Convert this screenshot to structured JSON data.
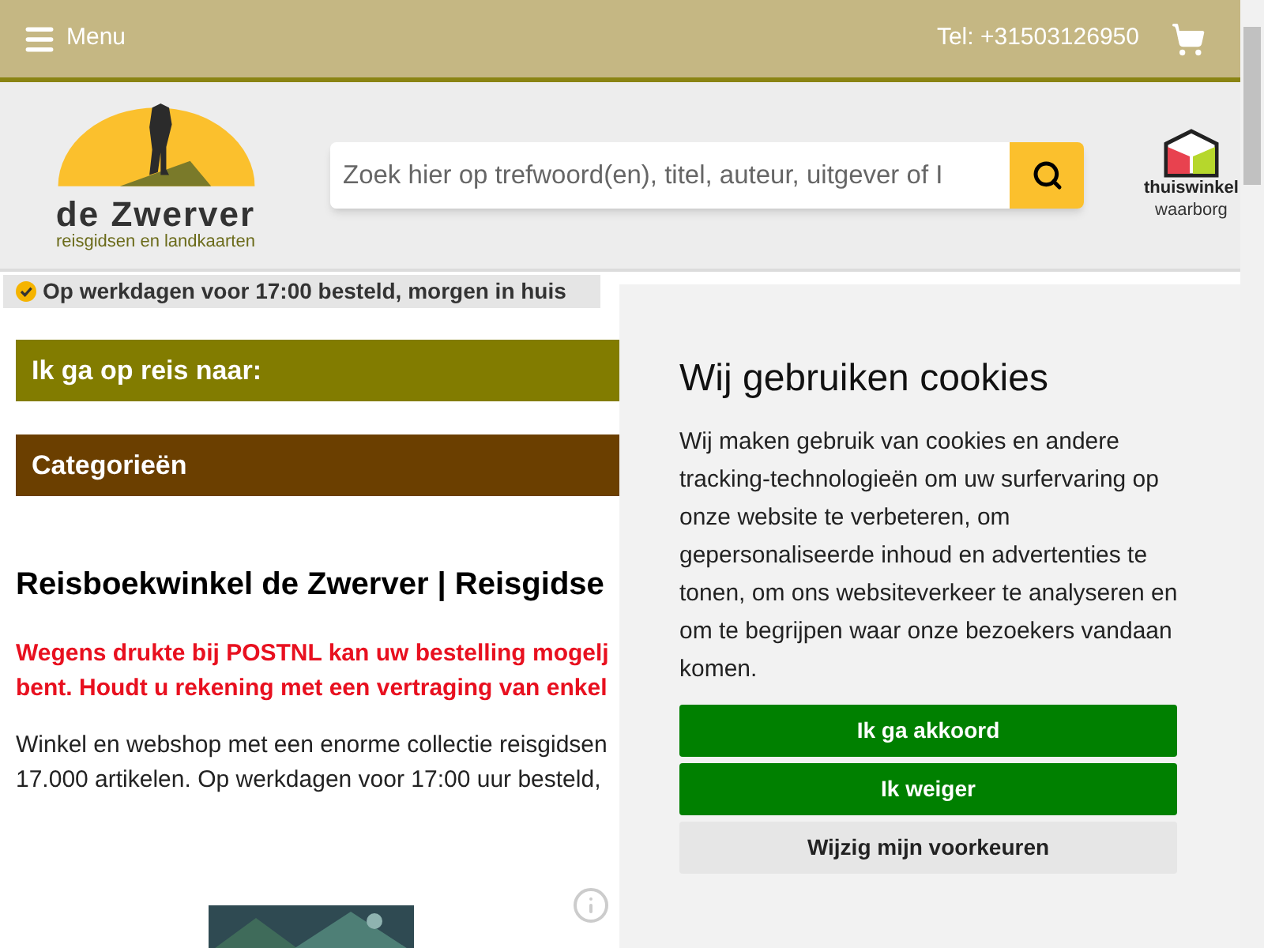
{
  "top_bar": {
    "menu_label": "Menu",
    "phone": "Tel: +31503126950"
  },
  "logo": {
    "name": "de Zwerver",
    "tagline": "reisgidsen en landkaarten"
  },
  "search": {
    "placeholder": "Zoek hier op trefwoord(en), titel, auteur, uitgever of I"
  },
  "trust_badge": {
    "line_1": "thuiswinkel",
    "line_2": "waarborg"
  },
  "notice": "Op werkdagen voor 17:00 besteld, morgen in huis",
  "sections": [
    {
      "label": "Ik ga op reis naar:",
      "color": "#827c00"
    },
    {
      "label": "Categorieën",
      "color": "#6b3f00"
    }
  ],
  "heading": "Reisboekwinkel de Zwerver | Reisgidse",
  "alert_lines": [
    "Wegens drukte bij POSTNL kan uw bestelling mogelj",
    "bent. Houdt u rekening met een vertraging van enkel"
  ],
  "intro_lines": [
    "Winkel en webshop met een enorme collectie reisgidsen",
    "17.000 artikelen. Op werkdagen voor 17:00 uur besteld,"
  ],
  "product": {
    "kind": "picture"
  },
  "cookie_dialog": {
    "title": "Wij gebruiken cookies",
    "text": "Wij maken gebruik van cookies en andere tracking-technologieën om uw surfervaring op onze website te verbeteren, om gepersonaliseerde inhoud en advertenties te tonen, om ons websiteverkeer te analyseren en om te begrijpen waar onze bezoekers vandaan komen.",
    "buttons": [
      {
        "label": "Ik ga akkoord",
        "kind": "primary"
      },
      {
        "label": "Ik weiger",
        "kind": "primary"
      },
      {
        "label": "Wijzig mijn voorkeuren",
        "kind": "secondary"
      }
    ]
  }
}
